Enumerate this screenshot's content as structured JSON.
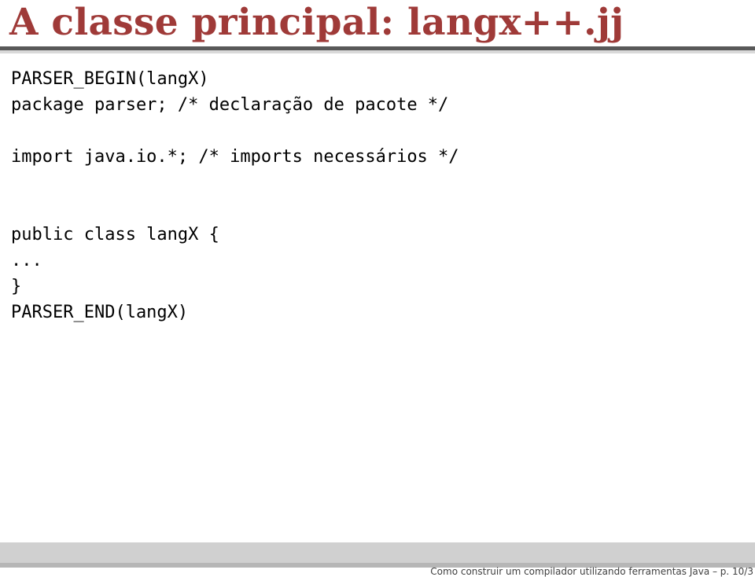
{
  "title": "A classe principal: langx++.jj",
  "code": {
    "line1": "PARSER_BEGIN(langX)",
    "line2": "package parser; /* declaração de pacote */",
    "line3": "",
    "line4": "import java.io.*; /* imports necessários */",
    "line5": "",
    "line6": "",
    "line7": "public class langX {",
    "line8": "...",
    "line9": "}",
    "line10": "PARSER_END(langX)"
  },
  "footer": "Como construir um compilador utilizando ferramentas Java – p. 10/3"
}
